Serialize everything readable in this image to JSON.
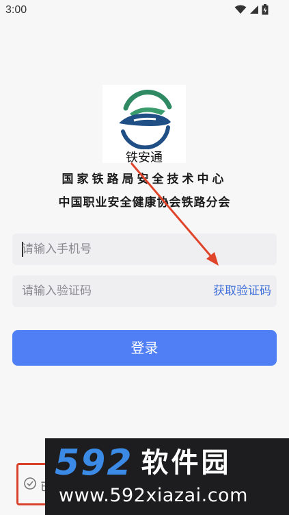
{
  "status_bar": {
    "time": "3:00",
    "icons": [
      "wifi-icon",
      "signal-icon",
      "battery-icon"
    ]
  },
  "app": {
    "logo_text": "铁安通",
    "org_line_1": "国家铁路局安全技术中心",
    "org_line_2": "中国职业安全健康协会铁路分会"
  },
  "login_form": {
    "phone_placeholder": "请输入手机号",
    "code_placeholder": "请输入验证码",
    "get_code_label": "获取验证码",
    "login_label": "登录"
  },
  "agreement": {
    "text": "已",
    "checkbox_icon": "check-circle-icon"
  },
  "watermark": {
    "brand_number": "592",
    "brand_name": "软件园",
    "url": "www.592xiazai.com"
  },
  "colors": {
    "accent": "#4f7ef5",
    "link": "#3f6fd9",
    "annotation": "#d9412a",
    "watermark_blue": "#3a8ae6"
  }
}
